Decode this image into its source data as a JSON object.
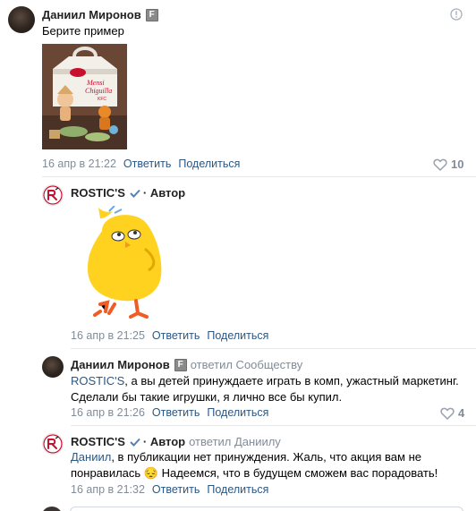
{
  "comments": [
    {
      "author": "Даниил Миронов",
      "badge": "F",
      "text": "Берите пример",
      "date": "16 апр в 21:22",
      "reply_label": "Ответить",
      "share_label": "Поделиться",
      "likes": "10",
      "photo_caption": "Mensi Chiguilla KFC"
    },
    {
      "author": "ROSTIC'S",
      "author_tag": "· Автор",
      "date": "16 апр в 21:25",
      "reply_label": "Ответить",
      "share_label": "Поделиться"
    },
    {
      "author": "Даниил Миронов",
      "badge": "F",
      "replied_to": "ответил Сообществу",
      "mention": "ROSTIC'S",
      "text_line1": ", а вы детей принуждаете играть в комп, ужастный маркетинг.",
      "text_line2": "Сделали бы такие игрушки, я лично все бы купил.",
      "date": "16 апр в 21:26",
      "reply_label": "Ответить",
      "share_label": "Поделиться",
      "likes": "4"
    },
    {
      "author": "ROSTIC'S",
      "author_tag": "· Автор",
      "replied_to": "ответил Даниилу",
      "mention": "Даниил",
      "text_line1": ", в публикации нет принуждения. Жаль, что акция вам не",
      "text_line2_a": "понравилась",
      "emoji": "😔",
      "text_line2_b": " Надеемся, что в будущем сможем вас порадовать!",
      "date": "16 апр в 21:32",
      "reply_label": "Ответить",
      "share_label": "Поделиться"
    }
  ],
  "colors": {
    "link": "#2a5885",
    "secondary": "#818c99",
    "brand_red": "#c8102e",
    "chick_yellow": "#ffd21f"
  }
}
